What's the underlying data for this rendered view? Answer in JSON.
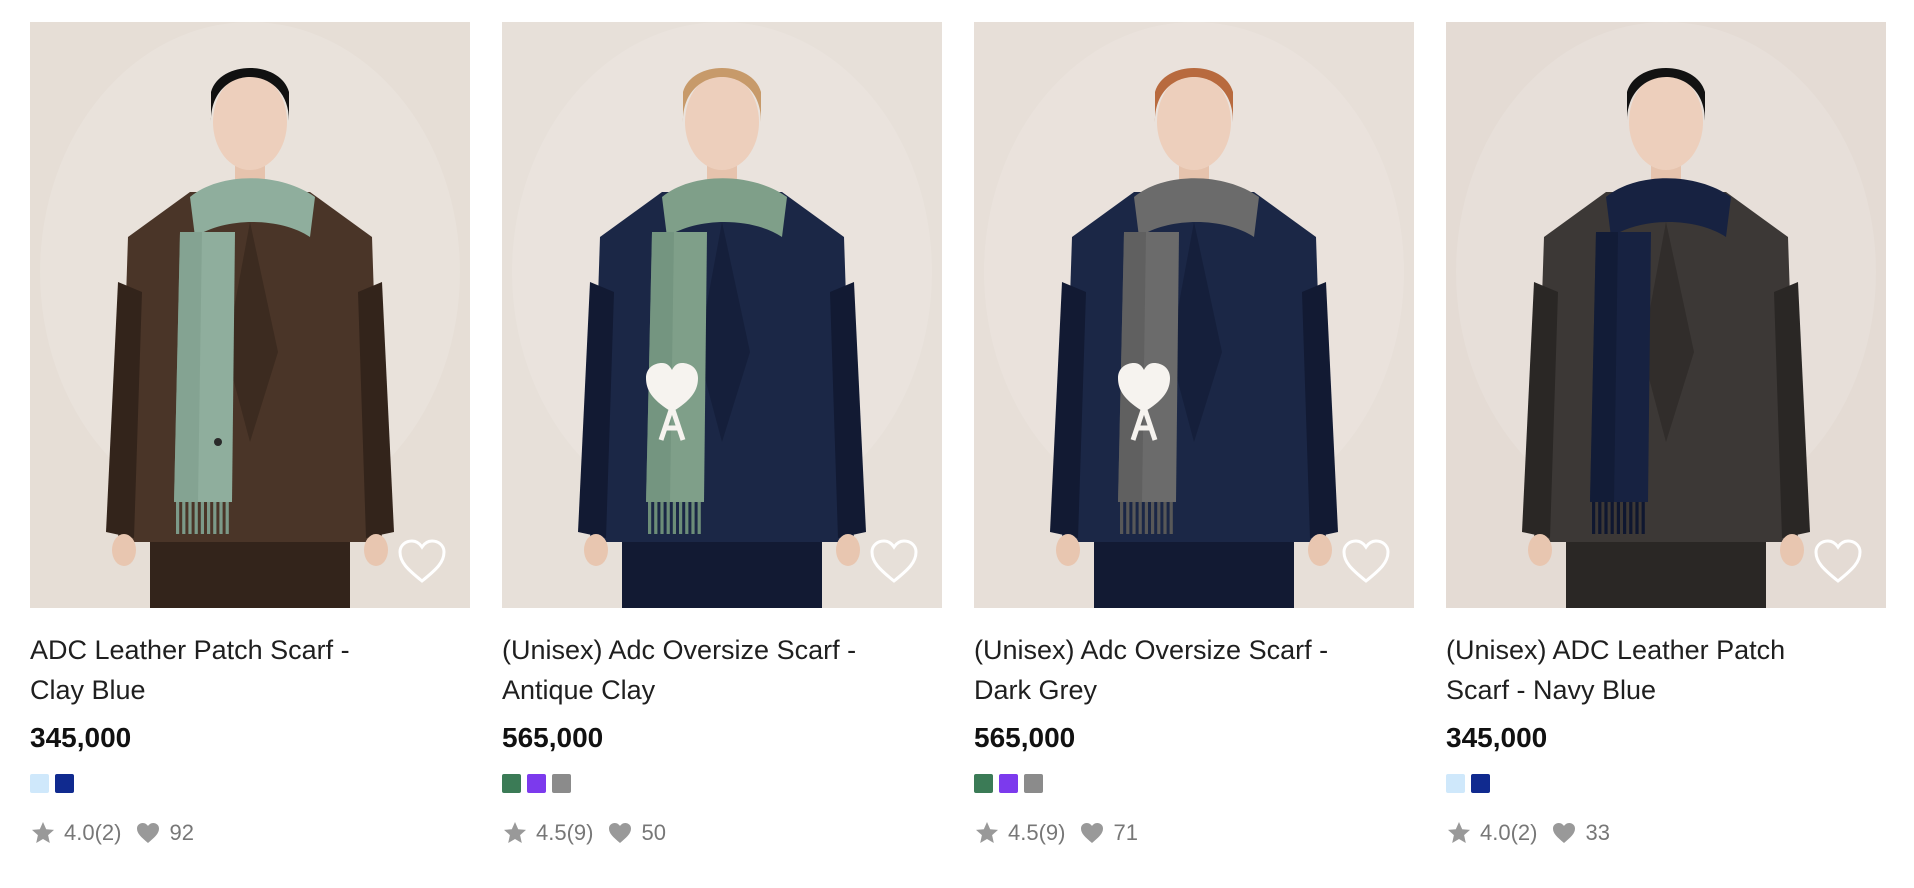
{
  "products": [
    {
      "title": "ADC Leather Patch Scarf - Clay Blue",
      "price": "345,000",
      "swatches": [
        "#cfe8fb",
        "#102a8f"
      ],
      "rating": "4.0(2)",
      "likes": "92",
      "image": {
        "bg": "#e6ded6",
        "coat": "#4a3528",
        "coat_dark": "#33241b",
        "scarf": "#8fae9d",
        "scarf_dark": "#7c9a89",
        "hair": "#111111",
        "logo": "heart-small"
      }
    },
    {
      "title": "(Unisex) Adc Oversize Scarf - Antique Clay",
      "price": "565,000",
      "swatches": [
        "#3b7b56",
        "#7c3aed",
        "#8b8b8b"
      ],
      "rating": "4.5(9)",
      "likes": "50",
      "image": {
        "bg": "#e7e0d9",
        "coat": "#1b2746",
        "coat_dark": "#121a33",
        "scarf": "#7f9f89",
        "scarf_dark": "#6c8d78",
        "hair": "#c79a6a",
        "logo": "heart-large"
      }
    },
    {
      "title": "(Unisex) Adc Oversize Scarf - Dark Grey",
      "price": "565,000",
      "swatches": [
        "#3b7b56",
        "#7c3aed",
        "#8b8b8b"
      ],
      "rating": "4.5(9)",
      "likes": "71",
      "image": {
        "bg": "#e7dfd8",
        "coat": "#1b2746",
        "coat_dark": "#121a33",
        "scarf": "#6b6b6b",
        "scarf_dark": "#585858",
        "hair": "#b86a3e",
        "logo": "heart-large"
      }
    },
    {
      "title": "(Unisex) ADC Leather Patch Scarf - Navy Blue",
      "price": "345,000",
      "swatches": [
        "#cfe8fb",
        "#102a8f"
      ],
      "rating": "4.0(2)",
      "likes": "33",
      "image": {
        "bg": "#e4dbd4",
        "coat": "#3c3836",
        "coat_dark": "#2a2725",
        "scarf": "#172241",
        "scarf_dark": "#0f1730",
        "hair": "#121212",
        "logo": "none"
      }
    }
  ],
  "icons": {
    "wishlist": "heart-outline-icon",
    "rating": "star-icon",
    "likes": "heart-filled-icon"
  }
}
